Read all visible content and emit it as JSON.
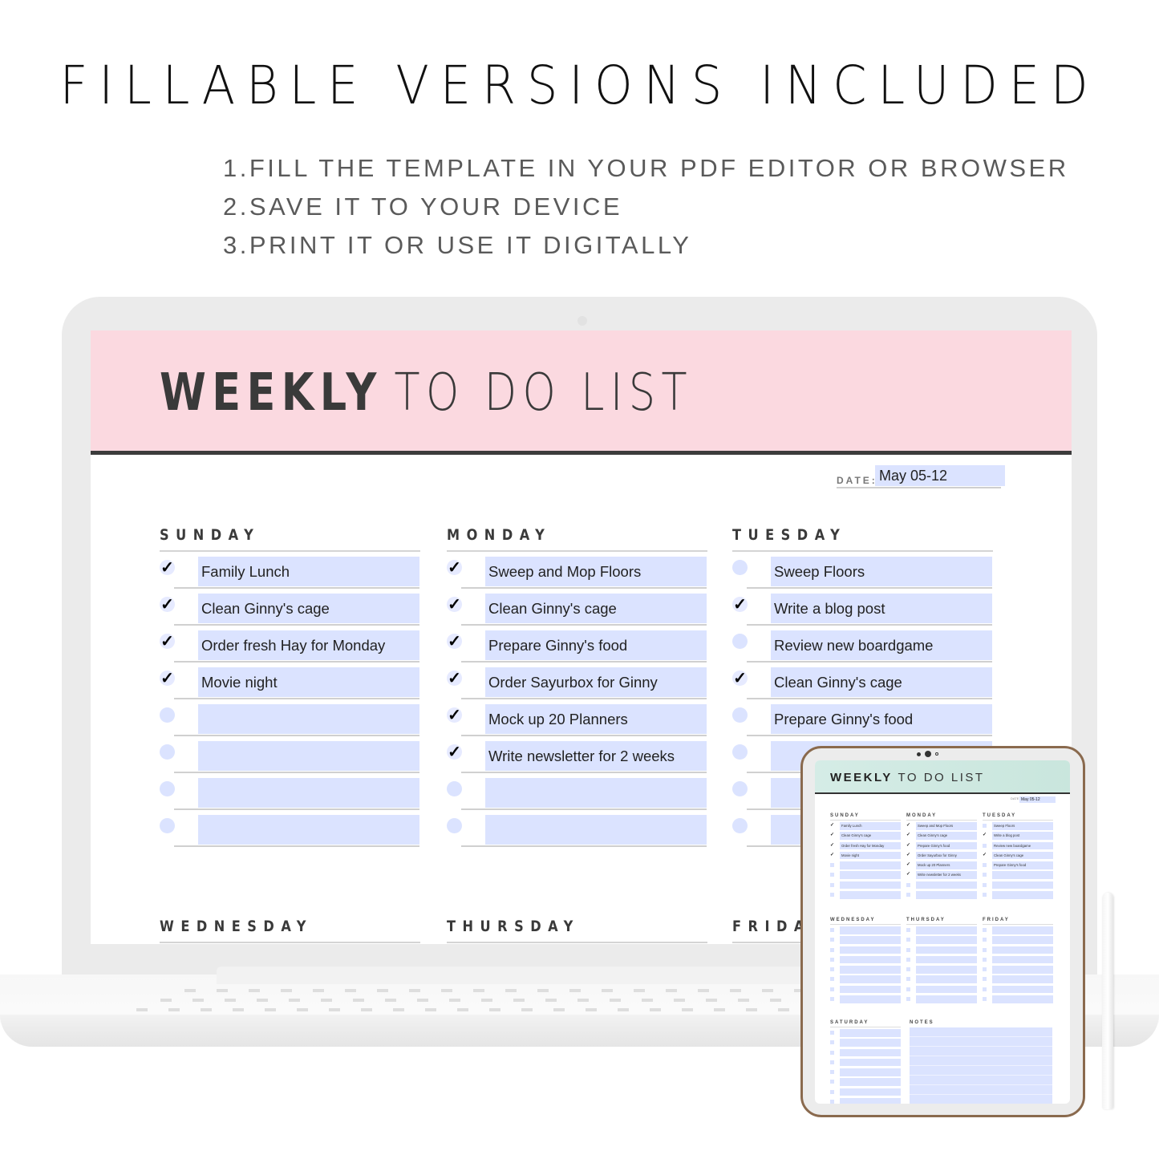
{
  "headline": "FILLABLE VERSIONS INCLUDED",
  "steps": [
    "1.FILL THE TEMPLATE IN YOUR PDF EDITOR OR BROWSER",
    "2.SAVE IT TO YOUR DEVICE",
    "3.PRINT IT OR USE IT DIGITALLY"
  ],
  "colors": {
    "banner_pink": "#fbd9e0",
    "banner_mint": "#d5ece6",
    "field_fill": "#dbe3ff",
    "rule_dark": "#3c3c3c",
    "tablet_frame": "#8a6a4e"
  },
  "planner": {
    "title_bold": "WEEKLY",
    "title_light": "TO DO LIST",
    "date_label": "DATE:",
    "date_value": "May 05-12",
    "days": [
      {
        "name": "SUNDAY",
        "tasks": [
          {
            "text": "Family Lunch",
            "done": true
          },
          {
            "text": "Clean Ginny's cage",
            "done": true
          },
          {
            "text": "Order fresh Hay for Monday",
            "done": true
          },
          {
            "text": "Movie night",
            "done": true
          },
          {
            "text": "",
            "done": false
          },
          {
            "text": "",
            "done": false
          },
          {
            "text": "",
            "done": false
          },
          {
            "text": "",
            "done": false
          }
        ]
      },
      {
        "name": "MONDAY",
        "tasks": [
          {
            "text": "Sweep and Mop Floors",
            "done": true
          },
          {
            "text": "Clean Ginny's cage",
            "done": true
          },
          {
            "text": "Prepare Ginny's food",
            "done": true
          },
          {
            "text": "Order Sayurbox for Ginny",
            "done": true
          },
          {
            "text": "Mock up 20 Planners",
            "done": true
          },
          {
            "text": "Write newsletter for 2 weeks",
            "done": true
          },
          {
            "text": "",
            "done": false
          },
          {
            "text": "",
            "done": false
          }
        ]
      },
      {
        "name": "TUESDAY",
        "tasks": [
          {
            "text": "Sweep Floors",
            "done": false
          },
          {
            "text": "Write a blog post",
            "done": true
          },
          {
            "text": "Review new boardgame",
            "done": false
          },
          {
            "text": "Clean Ginny's cage",
            "done": true
          },
          {
            "text": "Prepare Ginny's food",
            "done": false
          },
          {
            "text": "",
            "done": false
          },
          {
            "text": "",
            "done": false
          },
          {
            "text": "",
            "done": false
          }
        ]
      },
      {
        "name": "WEDNESDAY",
        "tasks": []
      },
      {
        "name": "THURSDAY",
        "tasks": []
      },
      {
        "name": "FRIDAY",
        "tasks": []
      }
    ]
  },
  "tablet": {
    "title_bold": "WEEKLY",
    "title_light": "TO DO LIST",
    "date_label": "DATE",
    "date_value": "May 05-12",
    "saturday_label": "SATURDAY",
    "notes_label": "NOTES"
  },
  "check_glyph": "✓"
}
